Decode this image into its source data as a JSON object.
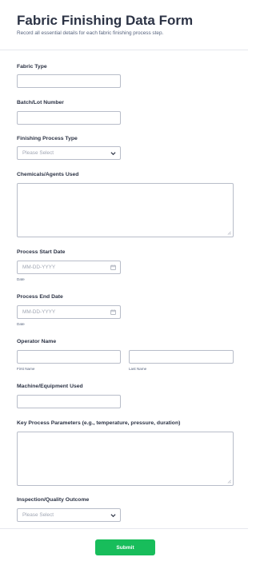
{
  "form": {
    "title": "Fabric Finishing Data Form",
    "subtitle": "Record all essential details for each fabric finishing process step."
  },
  "fields": {
    "fabric_type": {
      "label": "Fabric Type",
      "value": ""
    },
    "batch_lot": {
      "label": "Batch/Lot Number",
      "value": ""
    },
    "finishing_process": {
      "label": "Finishing Process Type",
      "placeholder": "Please Select"
    },
    "chemicals": {
      "label": "Chemicals/Agents Used",
      "value": ""
    },
    "start_date": {
      "label": "Process Start Date",
      "placeholder": "MM-DD-YYYY",
      "sublabel": "Date",
      "icon": "calendar-icon"
    },
    "end_date": {
      "label": "Process End Date",
      "placeholder": "MM-DD-YYYY",
      "sublabel": "Date",
      "icon": "calendar-icon"
    },
    "operator": {
      "label": "Operator Name",
      "first_sublabel": "First Name",
      "last_sublabel": "Last Name"
    },
    "machine": {
      "label": "Machine/Equipment Used",
      "value": ""
    },
    "parameters": {
      "label": "Key Process Parameters (e.g., temperature, pressure, duration)",
      "value": ""
    },
    "inspection": {
      "label": "Inspection/Quality Outcome",
      "placeholder": "Please Select"
    }
  },
  "footer": {
    "submit_label": "Submit"
  },
  "colors": {
    "accent": "#18bd5b",
    "border": "#b8bdc9",
    "text": "#2c3345",
    "muted": "#57647e",
    "placeholder": "#a0a6b3"
  }
}
